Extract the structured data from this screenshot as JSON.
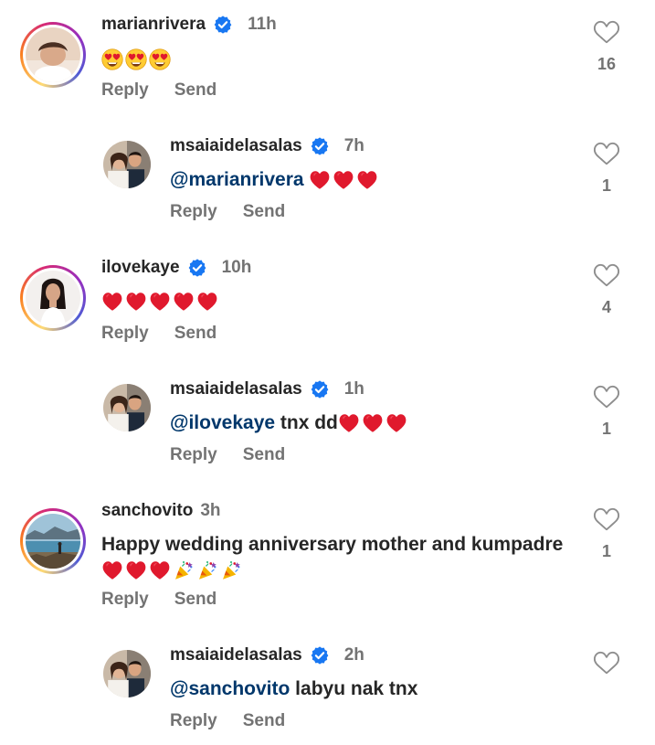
{
  "comments": [
    {
      "username": "marianrivera",
      "time": "11h",
      "emoji_heart_eyes_count": 3,
      "reply": "Reply",
      "send": "Send",
      "likes": "16"
    },
    {
      "username": "msaiaidelasalas",
      "time": "7h",
      "mention": "@marianrivera",
      "reply": "Reply",
      "send": "Send",
      "likes": "1"
    },
    {
      "username": "ilovekaye",
      "time": "10h",
      "reply": "Reply",
      "send": "Send",
      "likes": "4"
    },
    {
      "username": "msaiaidelasalas",
      "time": "1h",
      "mention": "@ilovekaye",
      "text": " tnx dd",
      "reply": "Reply",
      "send": "Send",
      "likes": "1"
    },
    {
      "username": "sanchovito",
      "time": "3h",
      "text": "Happy wedding anniversary mother and kumpadre",
      "reply": "Reply",
      "send": "Send",
      "likes": "1"
    },
    {
      "username": "msaiaidelasalas",
      "time": "2h",
      "mention": "@sanchovito",
      "text": " labyu nak tnx",
      "reply": "Reply",
      "send": "Send",
      "likes": ""
    }
  ],
  "icons": {
    "like": "heart-outline-icon",
    "verified": "verified-badge-icon",
    "heart_emoji": "red-heart-emoji",
    "heart_eyes_emoji": "heart-eyes-emoji",
    "party_emoji": "party-popper-emoji"
  },
  "colors": {
    "verified_blue": "#1877f2",
    "mention": "#00376b",
    "meta_gray": "#737373",
    "heart_red": "#e0192d"
  }
}
